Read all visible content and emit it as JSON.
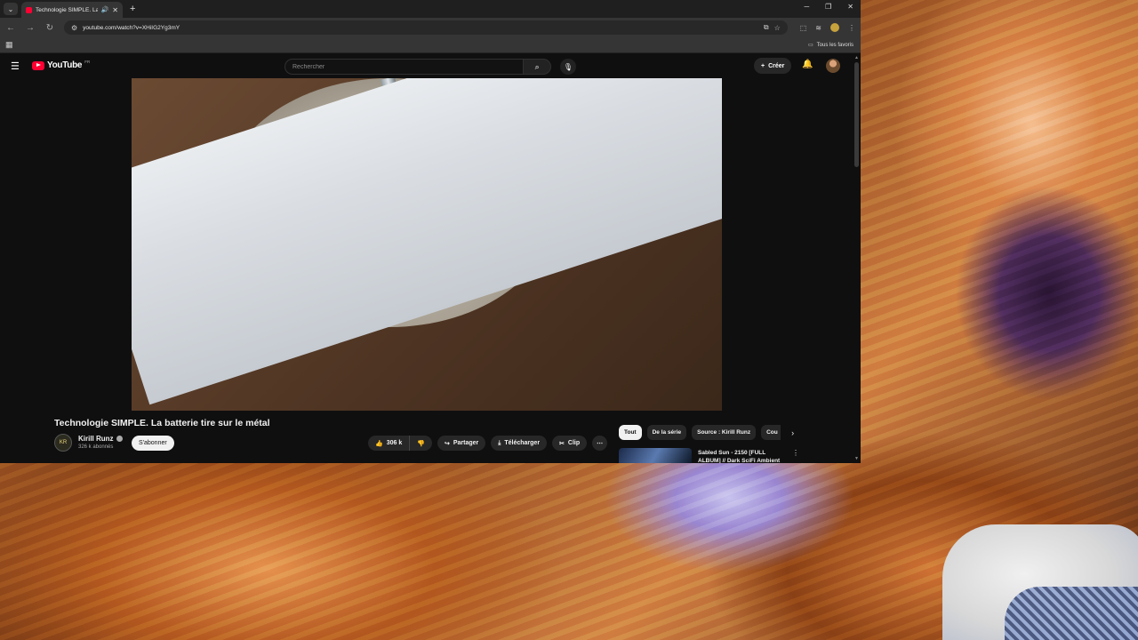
{
  "browser": {
    "tab_title": "Technologie SIMPLE. La batterie tire sur le métal",
    "url": "youtube.com/watch?v=XHiIG2Yg3mY",
    "bookmarks_all": "Tous les favoris"
  },
  "youtube": {
    "logo_text": "YouTube",
    "country_code": "FR",
    "search_placeholder": "Rechercher",
    "create_label": "Créer",
    "video": {
      "title": "Technologie SIMPLE. La batterie tire sur le métal",
      "channel_name": "Kirill Runz",
      "channel_initials": "KR",
      "subscribers": "326 k abonnés",
      "subscribe_label": "S'abonner",
      "likes": "306 k",
      "share_label": "Partager",
      "download_label": "Télécharger",
      "clip_label": "Clip"
    },
    "chips": [
      "Tout",
      "De la série",
      "Source : Kirill Runz",
      "Cou"
    ],
    "recommendation": {
      "title": "Sabled Sun - 2150 [FULL ALBUM] // Dark SciFi Ambient"
    }
  }
}
